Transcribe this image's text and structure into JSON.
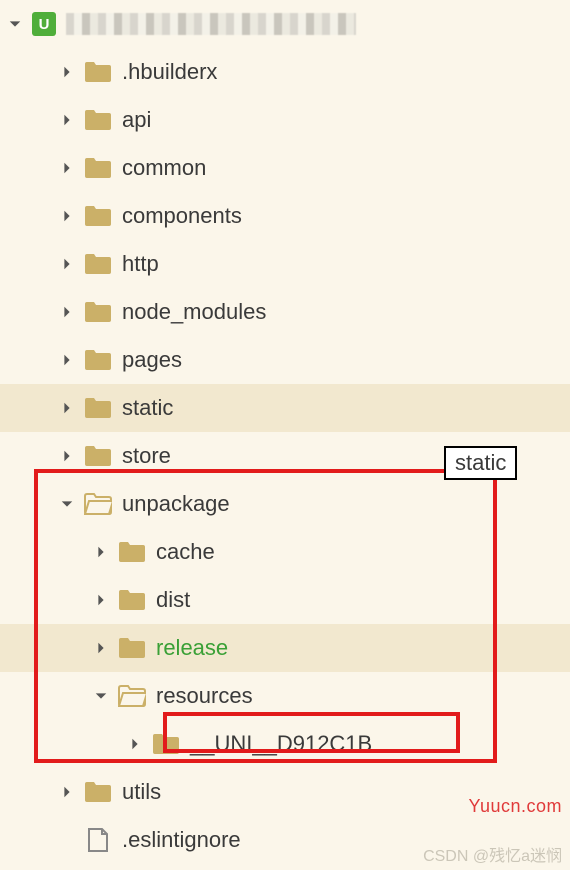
{
  "project": {
    "icon_letter": "U"
  },
  "tooltip": "static",
  "watermarks": {
    "w1": "Yuucn.com",
    "w2": "CSDN @残忆a迷悯"
  },
  "tree": {
    "items": [
      {
        "label": ".hbuilderx",
        "indent": 1,
        "expanded": false,
        "kind": "folder-closed"
      },
      {
        "label": "api",
        "indent": 1,
        "expanded": false,
        "kind": "folder-closed"
      },
      {
        "label": "common",
        "indent": 1,
        "expanded": false,
        "kind": "folder-closed"
      },
      {
        "label": "components",
        "indent": 1,
        "expanded": false,
        "kind": "folder-closed"
      },
      {
        "label": "http",
        "indent": 1,
        "expanded": false,
        "kind": "folder-closed"
      },
      {
        "label": "node_modules",
        "indent": 1,
        "expanded": false,
        "kind": "folder-closed"
      },
      {
        "label": "pages",
        "indent": 1,
        "expanded": false,
        "kind": "folder-closed"
      },
      {
        "label": "static",
        "indent": 1,
        "expanded": false,
        "kind": "folder-closed",
        "highlight": true
      },
      {
        "label": "store",
        "indent": 1,
        "expanded": false,
        "kind": "folder-closed"
      },
      {
        "label": "unpackage",
        "indent": 1,
        "expanded": true,
        "kind": "folder-open"
      },
      {
        "label": "cache",
        "indent": 2,
        "expanded": false,
        "kind": "folder-closed"
      },
      {
        "label": "dist",
        "indent": 2,
        "expanded": false,
        "kind": "folder-closed"
      },
      {
        "label": "release",
        "indent": 2,
        "expanded": false,
        "kind": "folder-closed",
        "green": true,
        "highlight": true
      },
      {
        "label": "resources",
        "indent": 2,
        "expanded": true,
        "kind": "folder-open"
      },
      {
        "label": "__UNI__D912C1B",
        "indent": 3,
        "expanded": false,
        "kind": "folder-closed"
      },
      {
        "label": "utils",
        "indent": 1,
        "expanded": false,
        "kind": "folder-closed"
      },
      {
        "label": ".eslintignore",
        "indent": 1,
        "expanded": null,
        "kind": "file"
      }
    ]
  }
}
